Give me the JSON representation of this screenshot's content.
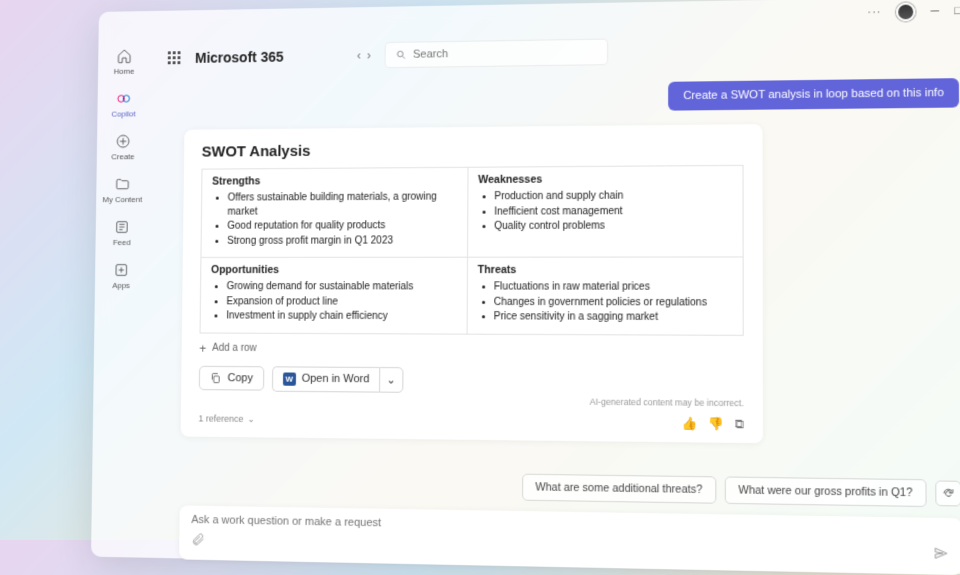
{
  "titlebar": {
    "more": "···"
  },
  "brand": "Microsoft 365",
  "search": {
    "placeholder": "Search"
  },
  "rail": {
    "items": [
      {
        "name": "home",
        "label": "Home"
      },
      {
        "name": "copilot",
        "label": "Copilot",
        "active": true
      },
      {
        "name": "create",
        "label": "Create"
      },
      {
        "name": "mycontent",
        "label": "My Content"
      },
      {
        "name": "feed",
        "label": "Feed"
      },
      {
        "name": "apps",
        "label": "Apps"
      }
    ]
  },
  "chat": {
    "user_message": "Create a SWOT analysis in loop based on this info",
    "response": {
      "title": "SWOT Analysis",
      "quadrants": {
        "strengths": {
          "title": "Strengths",
          "items": [
            "Offers sustainable building materials, a growing market",
            "Good reputation for quality products",
            "Strong gross profit margin in Q1 2023"
          ]
        },
        "weaknesses": {
          "title": "Weaknesses",
          "items": [
            "Production and supply chain",
            "Inefficient cost management",
            "Quality control problems"
          ]
        },
        "opportunities": {
          "title": "Opportunities",
          "items": [
            "Growing demand for sustainable materials",
            "Expansion of product line",
            "Investment in supply chain efficiency"
          ]
        },
        "threats": {
          "title": "Threats",
          "items": [
            "Fluctuations in raw material prices",
            "Changes in government policies or regulations",
            "Price sensitivity in a sagging market"
          ]
        }
      },
      "add_row": "Add a row",
      "actions": {
        "copy": "Copy",
        "open_word": "Open in Word"
      },
      "disclaimer": "AI-generated content may be incorrect.",
      "references_label": "1 reference"
    },
    "suggestions": [
      "What are some additional threats?",
      "What were our gross profits in Q1?"
    ],
    "composer_placeholder": "Ask a work question or make a request"
  }
}
